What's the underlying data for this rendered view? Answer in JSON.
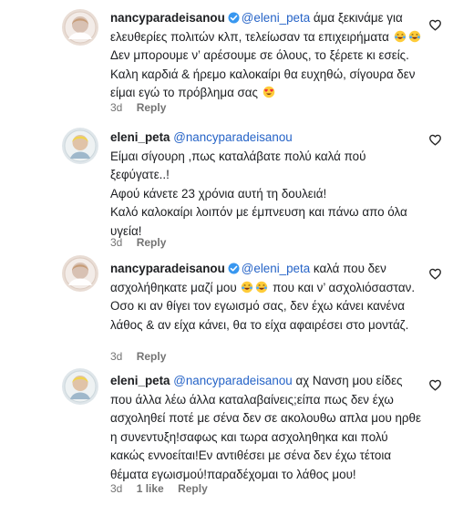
{
  "comments": [
    {
      "username": "nancyparadeisanou",
      "verified": true,
      "mention": "@eleni_peta",
      "text_1": " άμα ξεκινάμε για ελευθερίες πολιτών κλπ, τελείωσαν τα επιχειρήματα ",
      "emoji_1": "laughing-emoji",
      "emoji_2": "laughing-emoji",
      "text_2": " Δεν μπορουμε ν’ αρέσουμε σε όλους, το ξέρετε κι εσείς. Καλη καρδιά & ήρεμο καλοκαίρι θα ευχηθώ, σίγουρα δεν είμαι εγώ το πρόβλημα σας ",
      "emoji_3": "heart-eyes-emoji",
      "age": "3d",
      "reply_label": "Reply"
    },
    {
      "username": "eleni_peta",
      "verified": false,
      "mention": "@nancyparadeisanou",
      "line_1": "Είμαι σίγουρη ,πως καταλάβατε πολύ καλά πού ξεφύγατε..!",
      "line_2": "Αφού κάνετε 23 χρόνια αυτή τη δουλειά!",
      "line_3": "Καλό καλοκαίρι λοιπόν με έμπνευση και πάνω απο όλα υγεία!",
      "age": "3d",
      "reply_label": "Reply"
    },
    {
      "username": "nancyparadeisanou",
      "verified": true,
      "mention": "@eleni_peta",
      "text_1": " καλά που δεν ασχολήθηκατε μαζί μου ",
      "emoji_1": "laughing-emoji",
      "emoji_2": "laughing-emoji",
      "text_2": " που και ν’ ασχολιόσασταν. Οσο κι αν θίγει τον εγωισμό σας, δεν έχω κάνει κανένα λάθος & αν είχα κάνει, θα το είχα αφαιρέσει στο μοντάζ.",
      "age": "3d",
      "reply_label": "Reply"
    },
    {
      "username": "eleni_peta",
      "verified": false,
      "mention": "@nancyparadeisanou",
      "text_1": " αχ Νανση μου είδες που άλλα λέω άλλα καταλαβαίνεις;είπα πως δεν έχω ασχοληθεί ποτέ με σένα δεν σε ακολουθω απλα μου ηρθε η συνεντυξη!σαφως και τωρα ασχοληθηκα και πολύ κακώς εννοείται!Εν αντιθέσει με σένα δεν έχω τέτοια θέματα εγωισμού!παραδέχομαι το λάθος μου!",
      "age": "3d",
      "likes_label": "1 like",
      "reply_label": "Reply"
    }
  ],
  "icons": {
    "like": "heart-outline-icon",
    "verified": "verified-badge-icon"
  },
  "colors": {
    "mention": "#2563c7",
    "verified": "#3897f0",
    "muted": "#737373"
  }
}
